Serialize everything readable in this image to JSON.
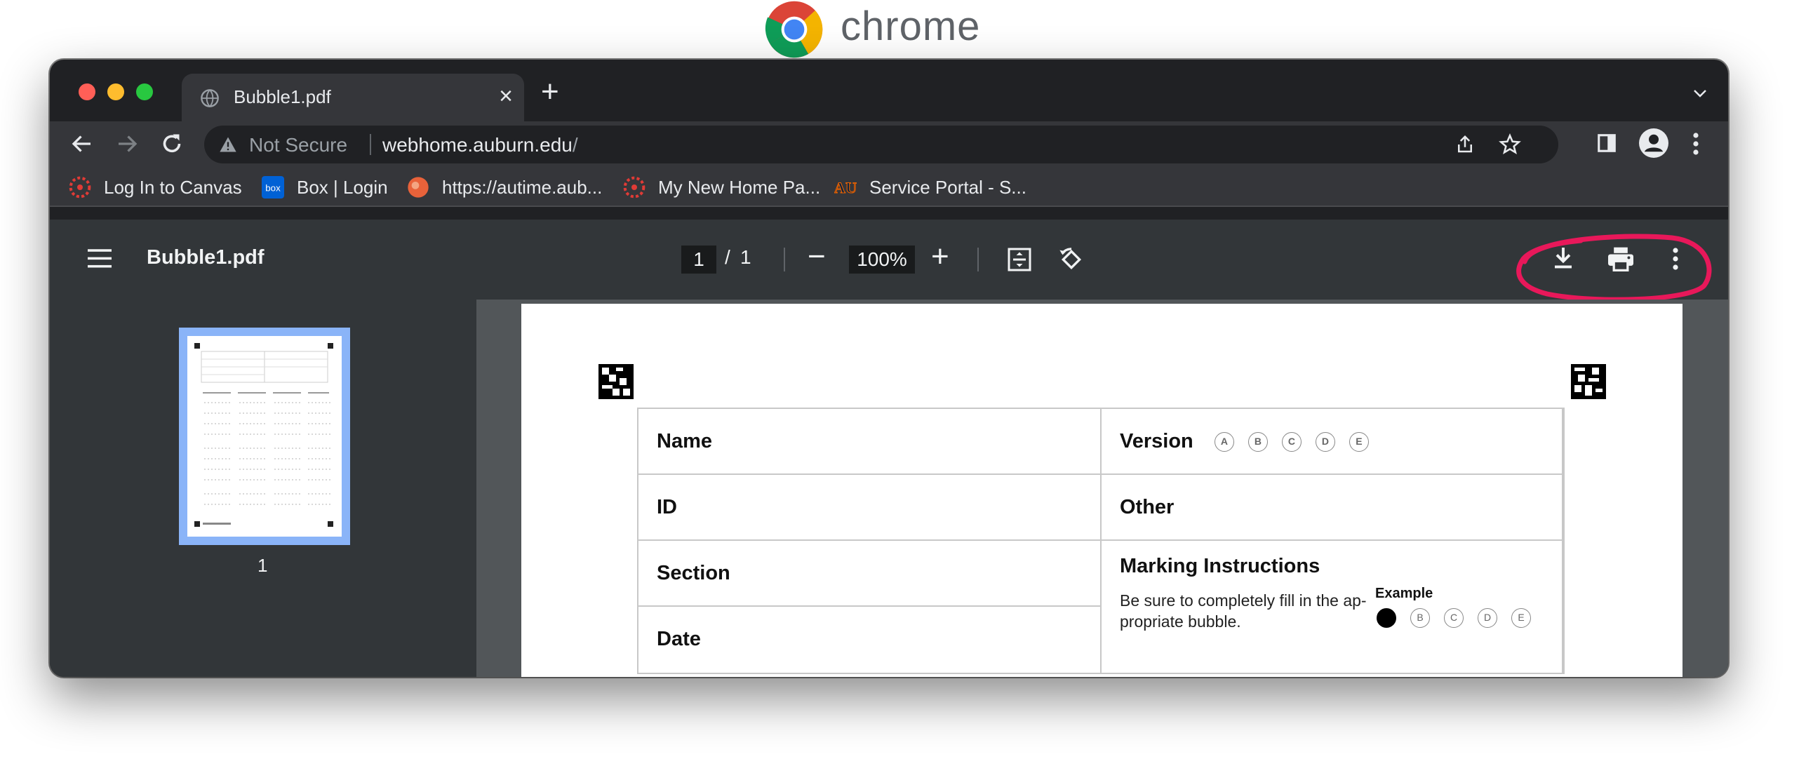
{
  "brand": {
    "word": "chrome"
  },
  "tab": {
    "title": "Bubble1.pdf",
    "close": "×",
    "new_tab": "+"
  },
  "omnibox": {
    "security": "Not Secure",
    "host": "webhome.auburn.edu",
    "path": "/"
  },
  "bookmarks": [
    {
      "label": "Log In to Canvas",
      "color": "#e03b36"
    },
    {
      "label": "Box | Login",
      "color": "#0061d5"
    },
    {
      "label": "https://autime.aub...",
      "color": "#e8623a"
    },
    {
      "label": "My New Home Pa...",
      "color": "#e03b36"
    },
    {
      "label": "Service Portal - S...",
      "color": "#0c2340"
    }
  ],
  "pdf": {
    "file_name": "Bubble1.pdf",
    "page_current": "1",
    "page_separator": "/",
    "page_total": "1",
    "zoom_out": "−",
    "zoom": "100%",
    "zoom_in": "+",
    "thumbnail_number": "1",
    "highlight_color": "#e8185a"
  },
  "form": {
    "name_label": "Name",
    "id_label": "ID",
    "section_label": "Section",
    "date_label": "Date",
    "version_label": "Version",
    "version_options": [
      "A",
      "B",
      "C",
      "D",
      "E"
    ],
    "other_label": "Other",
    "instructions_title": "Marking Instructions",
    "instructions_text": "Be sure to completely fill in the ap-propriate bubble.",
    "example_label": "Example",
    "example_options": [
      "",
      "B",
      "C",
      "D",
      "E"
    ]
  }
}
